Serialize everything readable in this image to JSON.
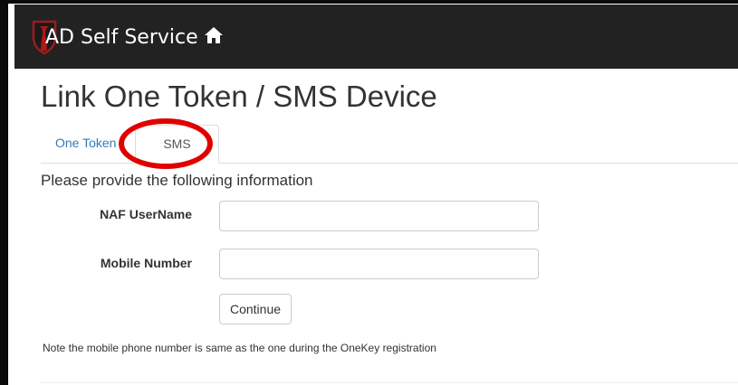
{
  "navbar": {
    "brand_text": "AD Self Service",
    "brand_logo_icon": "shield-icon",
    "home_icon": "home-icon",
    "background_color": "#222222"
  },
  "page": {
    "title": "Link One Token / SMS Device"
  },
  "tabs": {
    "items": [
      {
        "label": "One Token",
        "active": false
      },
      {
        "label": "SMS",
        "active": true
      }
    ],
    "highlight_color": "#e00000"
  },
  "form": {
    "heading": "Please provide the following information",
    "naf_username_label": "NAF UserName",
    "naf_username_value": "",
    "mobile_number_label": "Mobile Number",
    "mobile_number_value": "",
    "continue_label": "Continue"
  },
  "note": "Note the mobile phone number is same as the one during the OneKey registration"
}
